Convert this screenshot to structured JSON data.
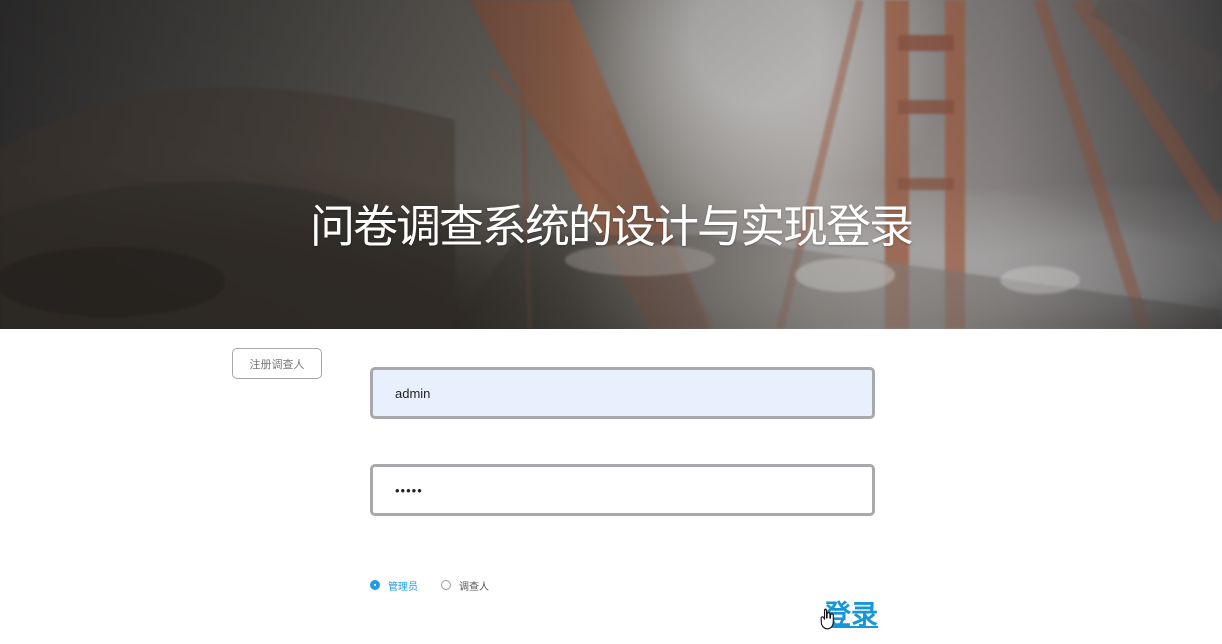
{
  "hero": {
    "title": "问卷调查系统的设计与实现登录"
  },
  "actions": {
    "register_label": "注册调查人",
    "login_label": "登录"
  },
  "form": {
    "username_value": "admin",
    "password_value": "•••••"
  },
  "roles": [
    {
      "label": "管理员",
      "selected": true
    },
    {
      "label": "调查人",
      "selected": false
    }
  ],
  "icons": {
    "cursor": "hand-cursor-icon",
    "radio_selected": "radio-selected-icon",
    "radio_unselected": "radio-unselected-icon"
  },
  "colors": {
    "accent": "#1596d8",
    "field_border": "#a8a8ad",
    "field_autofill": "#e8f0fd"
  }
}
